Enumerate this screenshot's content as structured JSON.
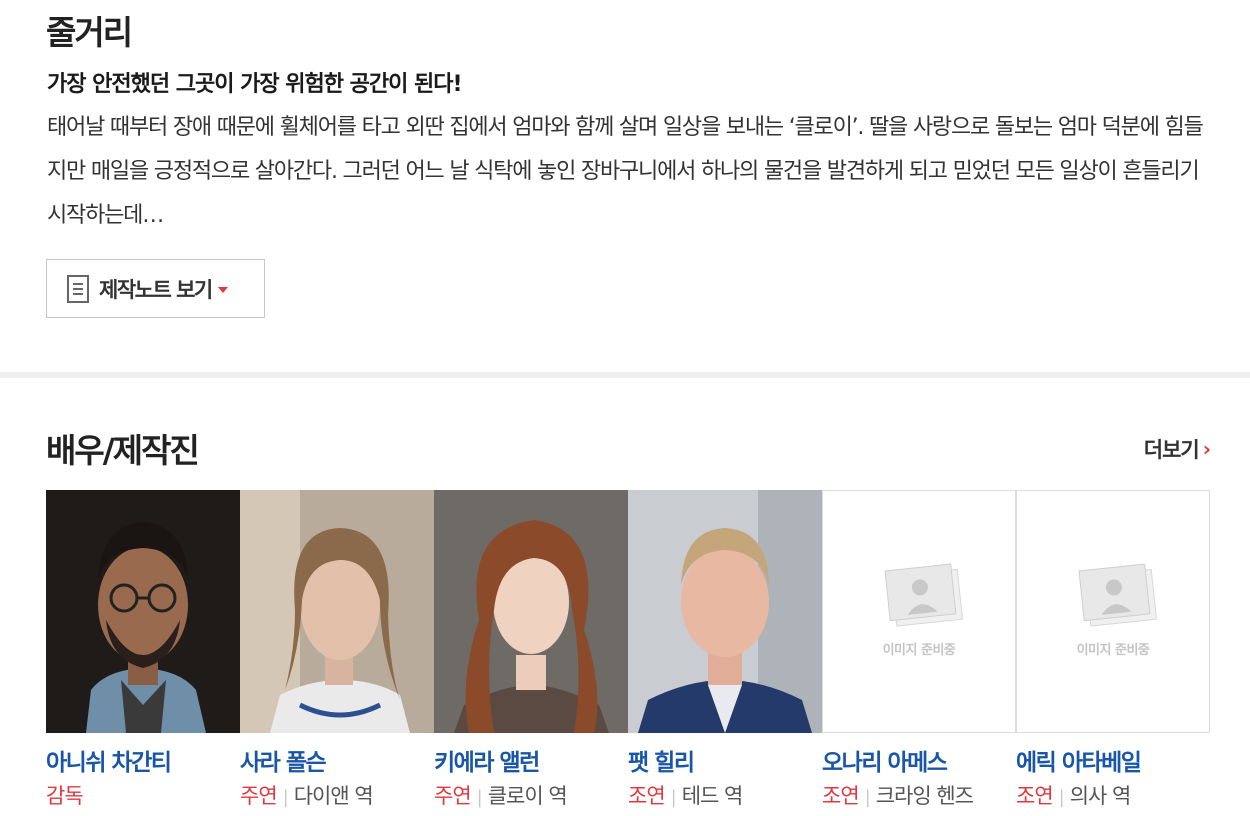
{
  "synopsis": {
    "title": "줄거리",
    "tagline": "가장 안전했던 그곳이 가장 위험한 공간이 된다!",
    "body": "태어날 때부터 장애 때문에 휠체어를 타고 외딴 집에서 엄마와 함께 살며 일상을 보내는 ‘클로이’. 딸을 사랑으로 돌보는 엄마 덕분에 힘들지만 매일을 긍정적으로 살아간다. 그러던 어느 날 식탁에 놓인 장바구니에서 하나의 물건을 발견하게 되고 믿었던 모든 일상이 흔들리기 시작하는데…",
    "note_button_label": "제작노트 보기"
  },
  "cast": {
    "title": "배우/제작진",
    "more_label": "더보기",
    "placeholder_text": "이미지 준비중",
    "members": [
      {
        "name": "아니쉬 차간티",
        "role_type": "감독",
        "character": ""
      },
      {
        "name": "사라 폴슨",
        "role_type": "주연",
        "character": "다이앤 역"
      },
      {
        "name": "키에라 앨런",
        "role_type": "주연",
        "character": "클로이 역"
      },
      {
        "name": "팻 힐리",
        "role_type": "조연",
        "character": "테드 역"
      },
      {
        "name": "오나리 아메스",
        "role_type": "조연",
        "character": "크라잉 헨즈"
      },
      {
        "name": "에릭 아타베일",
        "role_type": "조연",
        "character": "의사 역"
      }
    ]
  },
  "colors": {
    "accent": "#e0383e",
    "name_blue": "#1a56a8"
  }
}
